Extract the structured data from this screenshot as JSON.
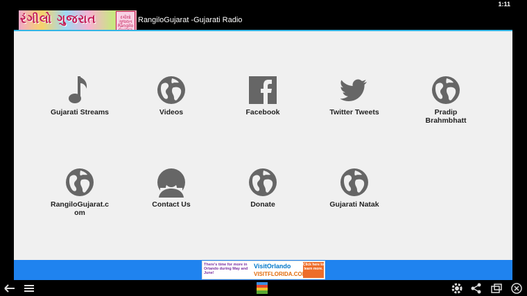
{
  "status": {
    "time": "1:11"
  },
  "actionbar": {
    "logo_text": "રંગીલો ગુજરાત",
    "logo_badge_text": "રંગીલો ગુજરાત Rangilo Gujarat.com",
    "title": "RangiloGujarat -Gujarati Radio"
  },
  "grid": {
    "items": [
      {
        "label": "Gujarati Streams",
        "icon": "music-note-icon"
      },
      {
        "label": "Videos",
        "icon": "globe-icon"
      },
      {
        "label": "Facebook",
        "icon": "facebook-icon"
      },
      {
        "label": "Twitter Tweets",
        "icon": "twitter-bird-icon"
      },
      {
        "label": "Pradip Brahmbhatt",
        "icon": "globe-icon"
      },
      {
        "label": "RangiloGujarat.com",
        "icon": "globe-icon"
      },
      {
        "label": "Contact Us",
        "icon": "person-icon"
      },
      {
        "label": "Donate",
        "icon": "globe-icon"
      },
      {
        "label": "Gujarati Natak",
        "icon": "globe-icon"
      }
    ]
  },
  "ad": {
    "left_text": "There's time for more in Orlando during May and June!",
    "brand": "VisitOrlando",
    "sub": "VISITFLORIDA.COM",
    "cta": "Click here to learn more."
  },
  "navbar": {
    "icons": [
      "back-arrow-icon",
      "menu-icon",
      "bluestacks-icon",
      "settings-icon",
      "share-icon",
      "screen-rotate-icon",
      "close-icon"
    ]
  },
  "colors": {
    "accent_line": "#33b5e5",
    "content_bg": "#f0f0f0",
    "icon_gray": "#666666",
    "ad_bar": "#1f83ef"
  }
}
